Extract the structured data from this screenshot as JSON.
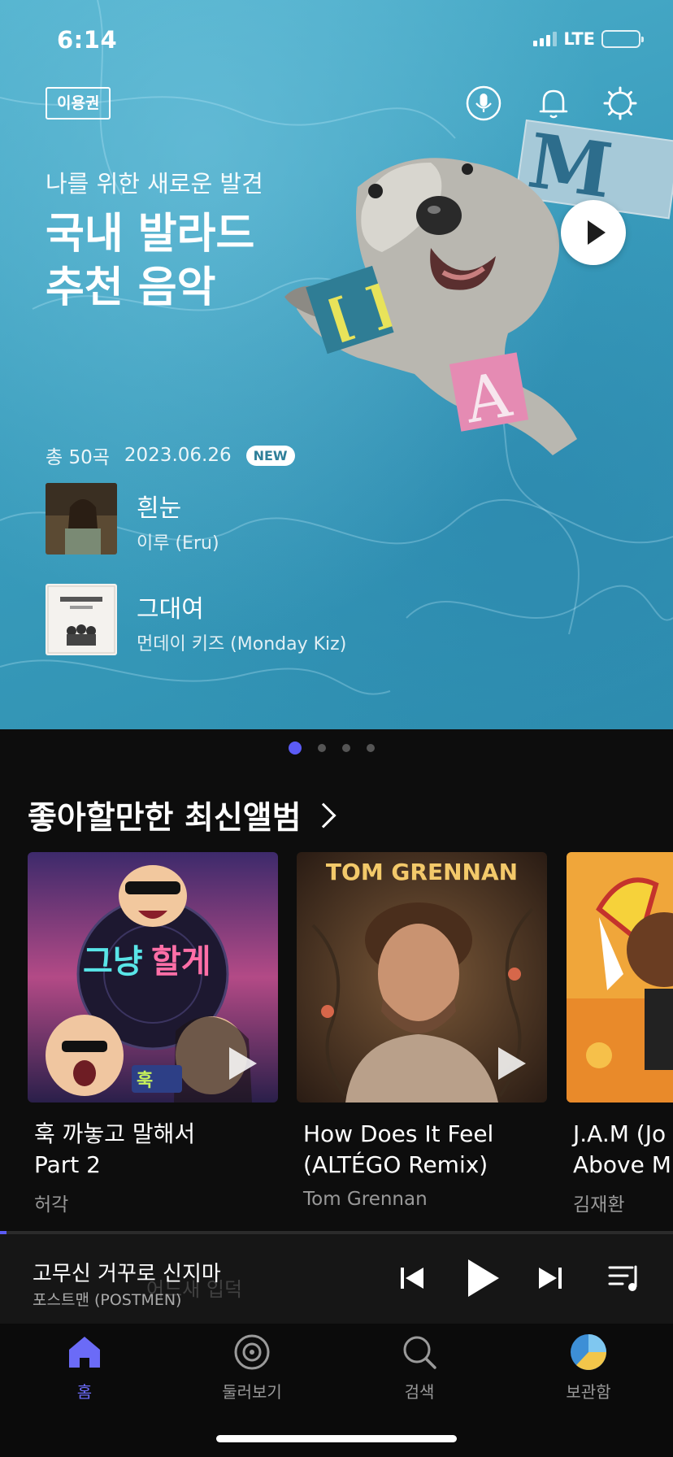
{
  "status_bar": {
    "time": "6:14",
    "network": "LTE"
  },
  "hero": {
    "voucher_label": "이용권",
    "icons": [
      "mic-icon",
      "bell-icon",
      "gear-icon"
    ],
    "subtitle": "나를 위한 새로운 발견",
    "title_line1": "국내 발라드",
    "title_line2": "추천 음악",
    "track_count": "총 50곡",
    "date": "2023.06.26",
    "new_badge": "NEW",
    "tracks": [
      {
        "title": "흰눈",
        "artist": "이루 (Eru)"
      },
      {
        "title": "그대여",
        "artist": "먼데이 키즈 (Monday Kiz)"
      }
    ]
  },
  "carousel": {
    "pages": 4,
    "active": 0
  },
  "section": {
    "title": "좋아할만한 최신앨범",
    "albums": [
      {
        "title_line1": "훅 까놓고 말해서",
        "title_line2": "Part 2",
        "artist": "허각"
      },
      {
        "title_line1": "How Does It Feel",
        "title_line2": "(ALTÉGO Remix)",
        "artist": "Tom Grennan",
        "cover_text": "TOM GRENNAN"
      },
      {
        "title_line1": "J.A.M (Jo",
        "title_line2": "Above M",
        "artist": "김재환"
      }
    ]
  },
  "mini_player": {
    "title": "고무신 거꾸로 신지마",
    "artist": "포스트맨 (POSTMEN)",
    "background_lyric": "어느새 입덕",
    "progress": 0.01
  },
  "tab_bar": {
    "items": [
      {
        "label": "홈",
        "icon": "home-icon",
        "active": true
      },
      {
        "label": "둘러보기",
        "icon": "disc-icon",
        "active": false
      },
      {
        "label": "검색",
        "icon": "search-icon",
        "active": false
      },
      {
        "label": "보관함",
        "icon": "library-icon",
        "active": false
      }
    ]
  },
  "colors": {
    "accent": "#5b5bf5",
    "hero_bg": "#3a9dbd",
    "background": "#0d0d0d"
  }
}
